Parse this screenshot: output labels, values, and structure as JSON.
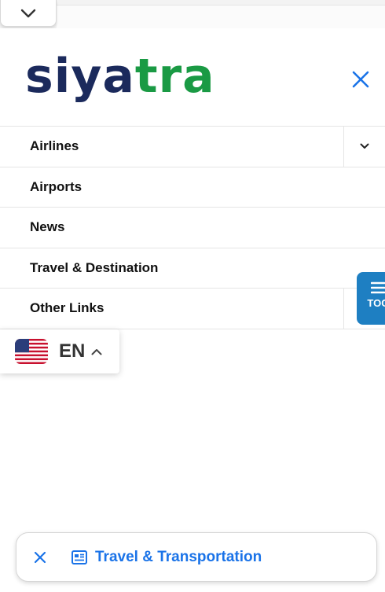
{
  "header": {
    "logo_part1": "siya",
    "logo_part2": "tra"
  },
  "menu": {
    "items": [
      {
        "label": "Airlines"
      },
      {
        "label": "Airports"
      },
      {
        "label": "News"
      },
      {
        "label": "Travel & Destination"
      },
      {
        "label": "Other Links"
      }
    ]
  },
  "toc": {
    "label": "TOC"
  },
  "language": {
    "code": "EN",
    "flag": "us-flag-icon"
  },
  "bottom_bar": {
    "label": "Travel & Transportation"
  },
  "colors": {
    "logo_navy": "#1b2a5c",
    "logo_green": "#1a9a44",
    "accent_blue": "#1a73e8",
    "toc_blue": "#1e7fc2"
  }
}
